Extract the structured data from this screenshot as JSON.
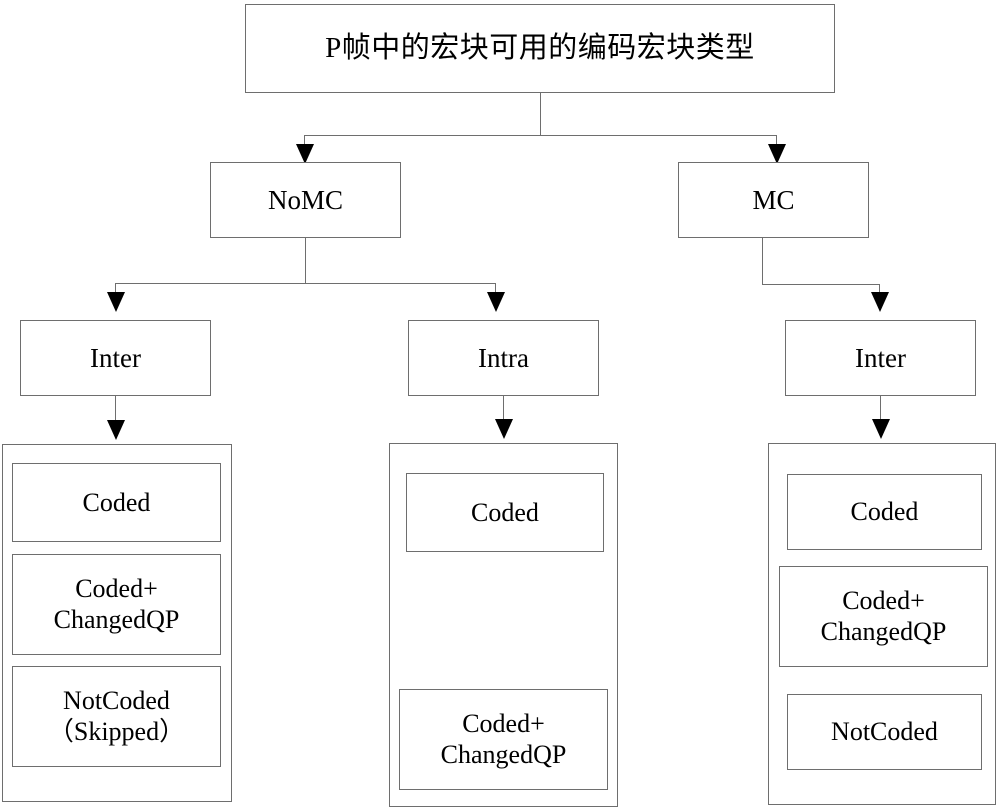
{
  "diagram": {
    "title": "P帧中的宏块可用的编码宏块类型",
    "level2": {
      "left": "NoMC",
      "right": "MC"
    },
    "level3": {
      "col1": "Inter",
      "col2": "Intra",
      "col3": "Inter"
    },
    "leaves": {
      "col1": [
        {
          "line1": "Coded",
          "line2": ""
        },
        {
          "line1": "Coded+",
          "line2": "ChangedQP"
        },
        {
          "line1": "NotCoded",
          "line2": "（Skipped）"
        }
      ],
      "col2": [
        {
          "line1": "Coded",
          "line2": ""
        },
        {
          "line1": "Coded+",
          "line2": "ChangedQP"
        }
      ],
      "col3": [
        {
          "line1": "Coded",
          "line2": ""
        },
        {
          "line1": "Coded+",
          "line2": "ChangedQP"
        },
        {
          "line1": "NotCoded",
          "line2": ""
        }
      ]
    },
    "colors": {
      "stroke": "#6e6e6e",
      "arrow": "#000000",
      "text": "#000000",
      "background": "#ffffff"
    }
  }
}
